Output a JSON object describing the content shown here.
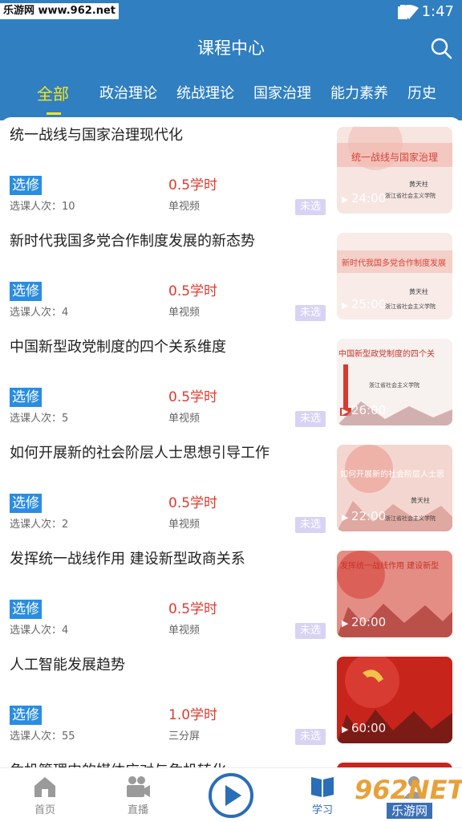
{
  "status_bar": {
    "watermark": "乐游网 www.962.net",
    "time": "1:47"
  },
  "header": {
    "title": "课程中心"
  },
  "tabs": [
    {
      "label": "全部",
      "active": true
    },
    {
      "label": "政治理论",
      "active": false
    },
    {
      "label": "统战理论",
      "active": false
    },
    {
      "label": "国家治理",
      "active": false
    },
    {
      "label": "能力素养",
      "active": false
    },
    {
      "label": "历史",
      "active": false
    }
  ],
  "courses": [
    {
      "title": "统一战线与国家治理现代化",
      "type": "选修",
      "hours": "0.5学时",
      "count": "选课人次：10",
      "format": "单视频",
      "status": "未选",
      "thumb_caption": "统一战线与国家治理",
      "thumb_speaker": "黄天柱",
      "thumb_org": "浙江省社会主义学院",
      "duration": "24:00"
    },
    {
      "title": "新时代我国多党合作制度发展的新态势",
      "type": "选修",
      "hours": "0.5学时",
      "count": "选课人次：4",
      "format": "单视频",
      "status": "未选",
      "thumb_caption": "新时代我国多党合作制度发展",
      "thumb_speaker": "黄天柱",
      "thumb_org": "浙江省社会主义学院",
      "duration": "25:00"
    },
    {
      "title": "中国新型政党制度的四个关系维度",
      "type": "选修",
      "hours": "0.5学时",
      "count": "选课人次：5",
      "format": "单视频",
      "status": "未选",
      "thumb_caption": "中国新型政党制度的四个关",
      "thumb_speaker": "",
      "thumb_org": "浙江省社会主义学院",
      "duration": "26:00"
    },
    {
      "title": "如何开展新的社会阶层人士思想引导工作",
      "type": "选修",
      "hours": "0.5学时",
      "count": "选课人次：2",
      "format": "单视频",
      "status": "未选",
      "thumb_caption": "如何开展新的社会阶层人士思",
      "thumb_speaker": "黄天柱",
      "thumb_org": "浙江省社会主义学院",
      "duration": "22:00"
    },
    {
      "title": "发挥统一战线作用 建设新型政商关系",
      "type": "选修",
      "hours": "0.5学时",
      "count": "选课人次：4",
      "format": "单视频",
      "status": "未选",
      "thumb_caption": "发挥统一战线作用 建设新型",
      "thumb_speaker": "",
      "thumb_org": "",
      "duration": "20:00"
    },
    {
      "title": "人工智能发展趋势",
      "type": "选修",
      "hours": "1.0学时",
      "count": "选课人次：55",
      "format": "三分屏",
      "status": "未选",
      "thumb_caption": "",
      "thumb_speaker": "",
      "thumb_org": "",
      "duration": "60:00"
    },
    {
      "title": "危机管理中的媒体应对与危机转化",
      "type": "",
      "hours": "",
      "count": "",
      "format": "",
      "status": "",
      "thumb_caption": "",
      "thumb_speaker": "",
      "thumb_org": "",
      "duration": ""
    }
  ],
  "bottom_nav": [
    {
      "label": "首页",
      "icon": "home-icon",
      "active": false
    },
    {
      "label": "直播",
      "icon": "live-camera-icon",
      "active": false
    },
    {
      "label": "",
      "icon": "play-circle-icon",
      "active": false
    },
    {
      "label": "学习",
      "icon": "book-icon",
      "active": true
    },
    {
      "label": "",
      "icon": "user-icon",
      "active": false
    }
  ],
  "watermark_br": {
    "top": "962NET",
    "bottom": "乐游网"
  },
  "colors": {
    "header_blue": "#2f7fc1",
    "tab_active": "#f5e51e",
    "type_badge": "#2a8de1",
    "hours_red": "#e03a2e",
    "status_badge": "#d8d3f5"
  }
}
